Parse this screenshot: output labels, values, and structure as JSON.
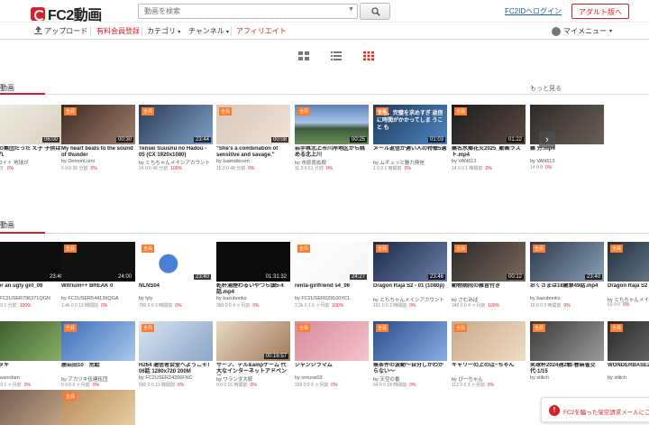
{
  "header": {
    "logo_text": "FC2動画",
    "search_placeholder": "動画を検索",
    "login_link": "FC2IDへログイン",
    "adult_button": "アダルト版へ"
  },
  "nav": {
    "upload": "アップロード",
    "premium": "有料会員登録",
    "category": "カテゴリ",
    "channel": "チャンネル",
    "affiliate": "アフィリエイト",
    "mymenu": "マイメニュー"
  },
  "sections": {
    "first_title": "動画",
    "first_more": "もっと見る",
    "second_title": "動画"
  },
  "row1": [
    {
      "title": "るでの集団だった え子 子供は生まれ",
      "user": "ジェロイト 地球が",
      "dur": "06:00",
      "stats": "  0 0 1 日 ",
      "pct": "0%",
      "badge": ""
    },
    {
      "title": "My heart beats to the sound of thunder",
      "user": "by DemonLumi",
      "dur": "00:30",
      "stats": "5  0  0    36 分前",
      "pct": "0%",
      "badge": "全員"
    },
    {
      "title": "Tensei Suushu no Hadou - 05 (CX 1920x1080)",
      "user": "by とちちゃんメインアカウント",
      "dur": "23:44",
      "stats": "24  0  0    46 分前",
      "pct": "100%",
      "badge": "全員"
    },
    {
      "title": "\"She's a combination of sensitive and savage.\"",
      "user": "by luamsibcom",
      "dur": "00:08",
      "stats": "15  0  0    48 分前",
      "pct": "0%",
      "badge": "全員"
    },
    {
      "title": "岩手県北上市川岸地区から眺める北上川",
      "user": "by 市原良拡樹",
      "dur": "00:25",
      "stats": "11  0  0    51 分前",
      "pct": "0%",
      "badge": "全員"
    },
    {
      "title": "メール返信が遅い人の特徴5選",
      "user": "by ムギュっと魅力発信",
      "dur": "01:03",
      "stats": "1  0  0    1 時間前",
      "pct": "0%",
      "badge": "全員"
    },
    {
      "title": "桑名水郷花火2025_動画ラスト.mp4",
      "user": "by VAN613",
      "dur": "01:22",
      "stats": "14  0  0    1 時間前",
      "pct": "0%",
      "badge": "全員"
    },
    {
      "title": "桑 分.mp4",
      "user": "by VAN613",
      "dur": "",
      "stats": "14  0  0",
      "pct": "0%",
      "badge": ""
    }
  ],
  "row1_overlay": "でも、完璧を求めすぎ 返信に時間がかかってしま うこと も",
  "row2": [
    {
      "title": "t for an ugly girl_06",
      "user": "by FC2USER796371QGN",
      "dur": "23:40",
      "stats": "0  0  0    1 分前",
      "pct": "100%",
      "badge": ""
    },
    {
      "title": "Witrium++ BREAK 0",
      "user": "by FC2USER544139QGA",
      "dur": "24:00",
      "stats": "1.4k  0  0    13 時間前",
      "pct": "0%",
      "badge": "全員"
    },
    {
      "title": "NLNS04",
      "user": "by lyly",
      "dur": "23:40",
      "stats": "700  0  0    3 時間前",
      "pct": "0%",
      "badge": "全員"
    },
    {
      "title": "乾杯湯煙わるいやつら頭5-4話.mp4",
      "user": "by kazubonks",
      "dur": "01:31:32",
      "stats": "360  0  0    4 ヶ月前",
      "pct": "0%",
      "badge": ""
    },
    {
      "title": "renta-girlfriend s4_06",
      "user": "by FC2USER029100YCL",
      "dur": "24:27",
      "stats": "2.3k  0  1    6 ヶ月前",
      "pct": "100%",
      "badge": "全員"
    },
    {
      "title": "Dragon Raja S2 - 01 (1080p)",
      "user": "by とちちゃんメインアカウント",
      "dur": "23:46",
      "stats": "161  0  0    3 時間前",
      "pct": "0%",
      "badge": "全員"
    },
    {
      "title": "動物病院の雑音付き",
      "user": "by さむみぽ",
      "dur": "00:12",
      "stats": "345  0  0    4 ヶ月前",
      "pct": "100%",
      "badge": "全員"
    },
    {
      "title": "おくさまは18歳第49話.mp4",
      "user": "by kazubonks",
      "dur": "23:40",
      "stats": "15  0  0    3 時間前",
      "pct": "0%",
      "badge": "全員"
    },
    {
      "title": "Dragon Raja S2",
      "user": "by とちちゃんメイ",
      "dur": "23:46",
      "stats": "63  0  0",
      "pct": "0%",
      "badge": "全員"
    }
  ],
  "row3": [
    {
      "title": "ヒタキ",
      "user": "by wanotam",
      "dur": "",
      "stats": "0  0  0    1 ヶ月前",
      "pct": "0%",
      "badge": ""
    },
    {
      "title": "鹿岩田10　荒絵",
      "user": "by アカツキ伍建伍団",
      "dur": "",
      "stats": "0  0  0    6 ヶ月前",
      "pct": "0%",
      "badge": "全員"
    },
    {
      "title": "H264 通信者会堂へようこそ！ 06話 1280x720 200M",
      "user": "by FC2USER24206FNC",
      "dur": "",
      "stats": "560  0  0    13 時間前",
      "pct": "0%",
      "badge": "全員"
    },
    {
      "title": "サーフ、テル&ampゲーム 代大なインターネットアドベンチャー",
      "user": "by ワランダ大統",
      "dur": "00:16:57",
      "stats": "0  0  0    16 時間前",
      "pct": "0%",
      "badge": ""
    },
    {
      "title": "ジャンジラマム",
      "user": "by ornurai03",
      "dur": "",
      "stats": "209  0  0    6 ヶ月前",
      "pct": "0%",
      "badge": "全員"
    },
    {
      "title": "無条件の波動～自分しかわからない～",
      "user": "by 天空の番",
      "dur": "",
      "stats": "64  0  0    18 時間前",
      "pct": "0%",
      "badge": "全員"
    },
    {
      "title": "キャリーの上のば~ちゃん",
      "user": "by びーちゃん",
      "dur": "",
      "stats": "112  0  0    3 ヶ月前",
      "pct": "0%",
      "badge": "全員"
    },
    {
      "title": "笑球杯2024週2戦-春麻雀交代-1/15",
      "user": "by stilich",
      "dur": "",
      "stats": "",
      "pct": "",
      "badge": "全員"
    },
    {
      "title": "WONDERBASE20 8/16",
      "user": "by stilich",
      "dur": "",
      "stats": "",
      "pct": "",
      "badge": "全員"
    }
  ],
  "floating_notice": "FC2を騙った架空請求メールにご注意"
}
